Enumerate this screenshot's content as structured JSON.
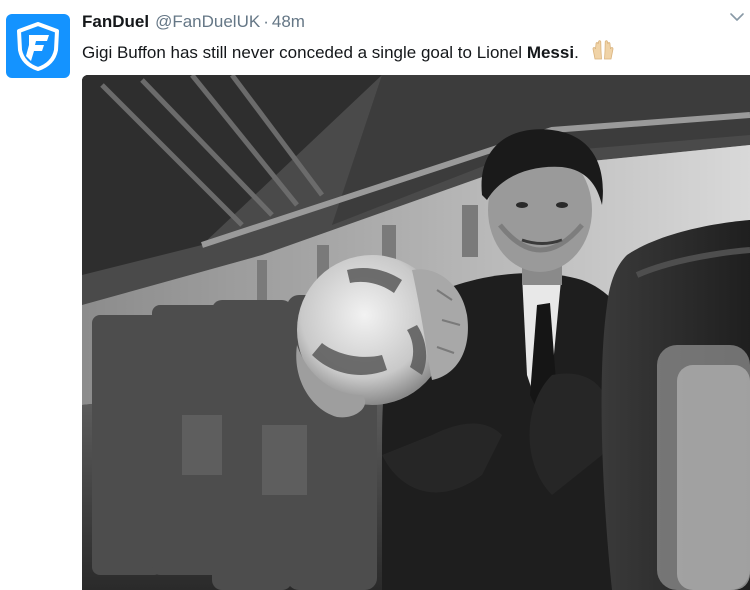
{
  "tweet": {
    "display_name": "FanDuel",
    "handle": "@FanDuelUK",
    "separator": "·",
    "timestamp": "48m",
    "text_before": "Gigi Buffon has still never conceded a single goal to Lionel ",
    "text_bold": "Messi",
    "text_after": ".",
    "emoji_icon": "raised-hands-icon",
    "brand_color": "#1493ff",
    "avatar_icon": "fanduel-shield-logo-icon",
    "menu_icon": "chevron-down-icon",
    "media_icon": "black-and-white-gif-player-holding-ball-on-airplane"
  }
}
